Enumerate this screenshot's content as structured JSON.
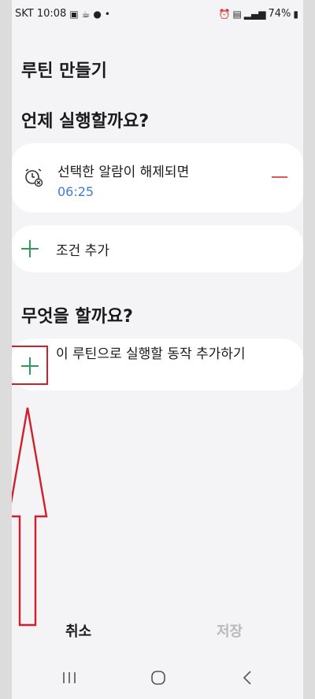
{
  "status_bar": {
    "carrier_time": "SKT 10:08",
    "battery": "74%",
    "right_icons": [
      "alarm-icon",
      "5g-icon",
      "signal-icon",
      "battery-icon"
    ],
    "left_icons": [
      "gallery-icon",
      "coffee-icon",
      "talk-icon",
      "dot-icon"
    ]
  },
  "page": {
    "title": "루틴 만들기"
  },
  "when_section": {
    "title": "언제 실행할까요?",
    "trigger": {
      "label": "선택한 알람이 해제되면",
      "time": "06:25"
    },
    "add_condition_label": "조건 추가"
  },
  "what_section": {
    "title": "무엇을 할까요?",
    "add_action_label": "이 루틴으로 실행할 동작 추가하기"
  },
  "bottom_actions": {
    "cancel": "취소",
    "save": "저장"
  },
  "colors": {
    "accent_green": "#2e9a5e",
    "time_blue": "#3e7bd6",
    "remove_red": "#e05555",
    "highlight_red": "#d01e2b",
    "disabled_gray": "#b9b9b9"
  }
}
